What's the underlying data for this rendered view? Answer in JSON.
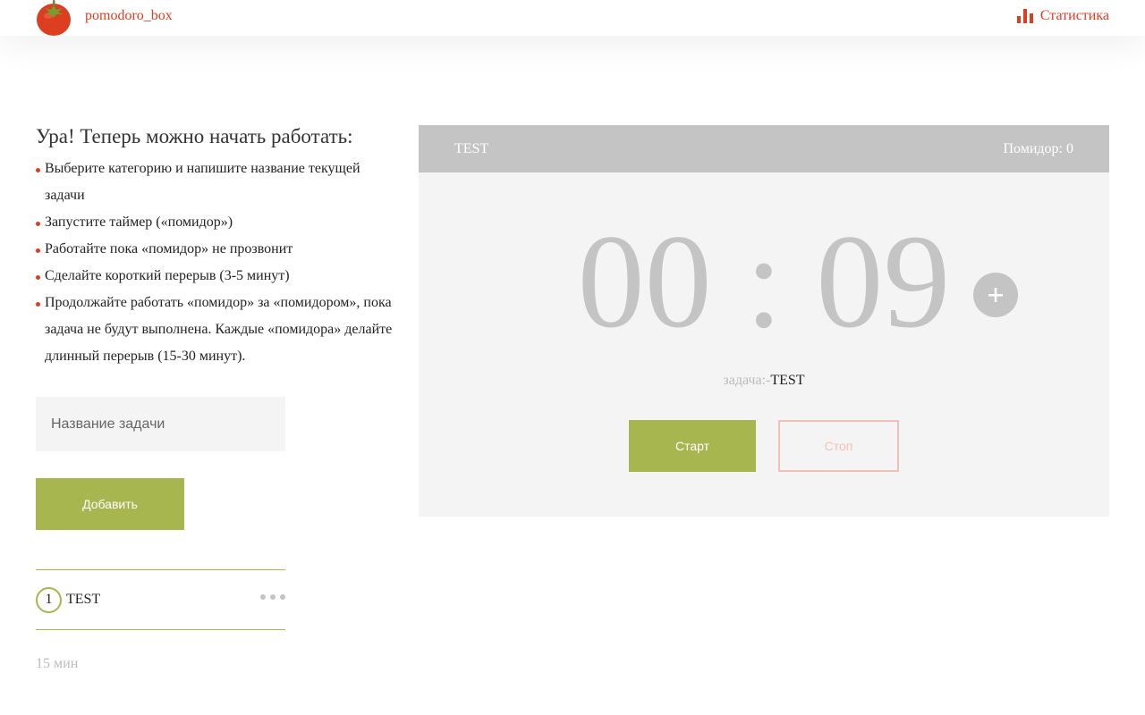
{
  "header": {
    "brand": "pomodoro_box",
    "stats_label": "Статистика",
    "logo_icon": "tomato-icon",
    "stats_icon": "bar-chart-icon"
  },
  "intro": {
    "title": "Ура! Теперь можно начать работать:",
    "steps": [
      "Выберите категорию и напишите название текущей задачи",
      "Запустите таймер («помидор»)",
      "Работайте пока «помидор» не прозвонит",
      "Сделайте короткий перерыв (3-5 минут)",
      "Продолжайте работать «помидор» за «помидором», пока задача не будут выполнена. Каждые «помидора» делайте длинный перерыв (15-30 минут)."
    ]
  },
  "form": {
    "input_placeholder": "Название задачи",
    "input_value": "",
    "add_label": "Добавить"
  },
  "tasks": [
    {
      "count": "1",
      "name": "TEST",
      "menu_icon": "more-dots-icon"
    }
  ],
  "total_time": "15 мин",
  "timer": {
    "task_title": "TEST",
    "pomodoro_label": "Помидор: 0",
    "time": "00 : 09",
    "plus_icon": "plus-icon",
    "caption_label": "задача:-",
    "caption_value": "TEST",
    "start_label": "Старт",
    "stop_label": "Стоп"
  },
  "colors": {
    "accent_red": "#dc3e22",
    "accent_green": "#a8b64f",
    "panel_grey": "#c4c4c4",
    "panel_bg": "#f4f4f4",
    "stop_border": "#f1c0b6"
  }
}
